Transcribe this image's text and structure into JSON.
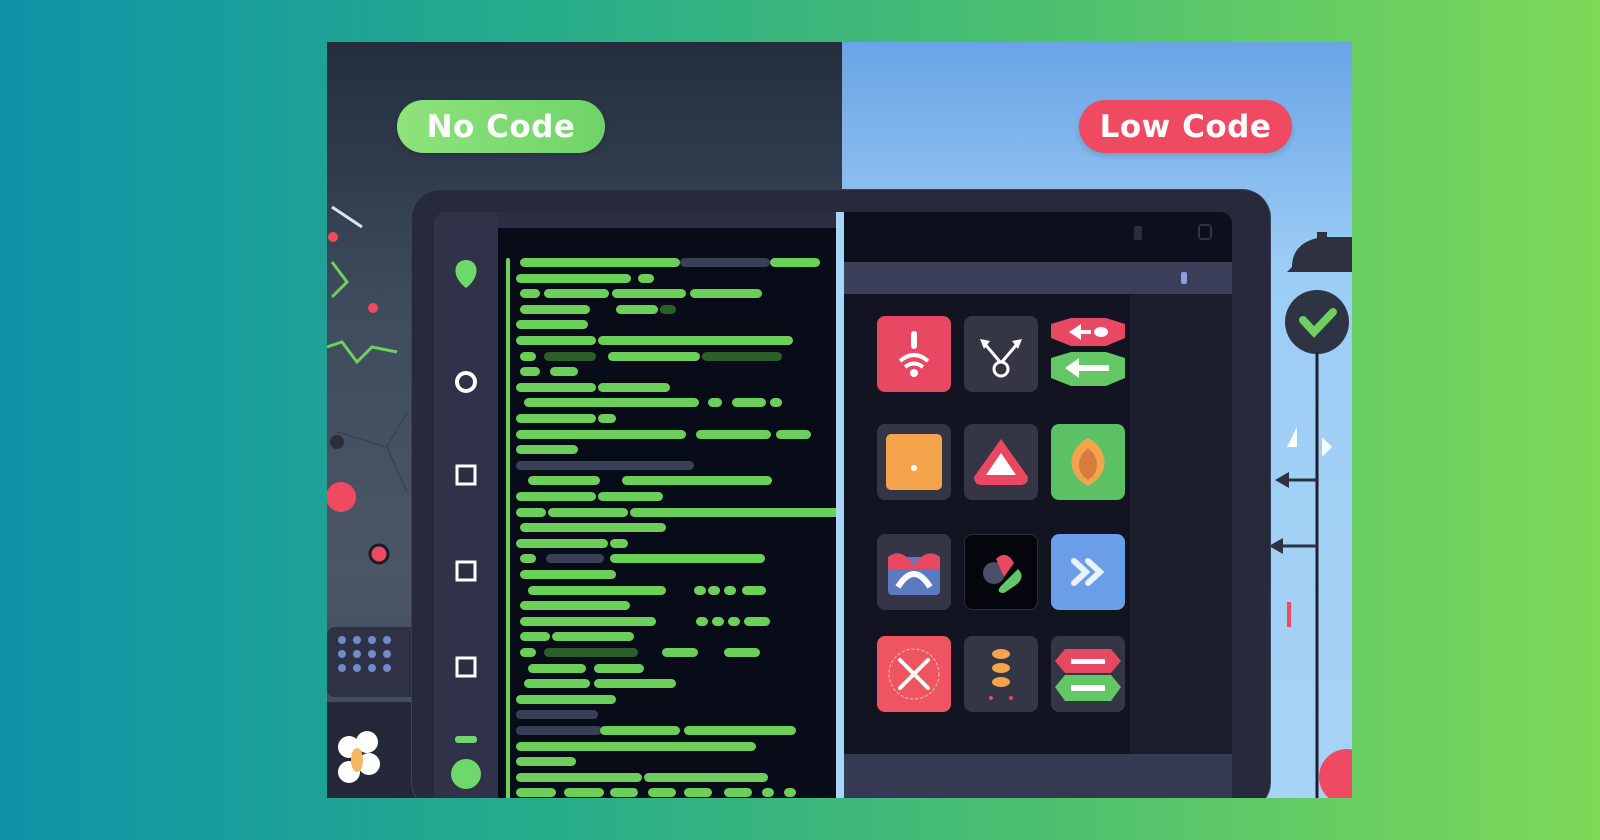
{
  "labels": {
    "no_code": "No Code",
    "low_code": "Low Code"
  },
  "colors": {
    "no_code_pill": "#7ed96c",
    "low_code_pill": "#ef4a62",
    "code_green": "#6ccf5a",
    "accent_red": "#ec4a62",
    "accent_orange": "#f4a54c",
    "accent_blue": "#6b9ee8"
  },
  "editor": {
    "sidebar_icons": [
      "leaf-icon",
      "circle-icon",
      "square-icon",
      "square-icon",
      "square-icon",
      "dash-icon",
      "dot-icon"
    ]
  },
  "builder": {
    "tiles": [
      {
        "name": "alert-wifi-tile",
        "icon": "alert-wifi-icon"
      },
      {
        "name": "branch-tile",
        "icon": "branch-arrows-icon"
      },
      {
        "name": "arrow-blocks-tile",
        "icon": "arrow-left-icon"
      },
      {
        "name": "orange-box-tile",
        "icon": "box-icon"
      },
      {
        "name": "warning-tile",
        "icon": "triangle-icon"
      },
      {
        "name": "seed-tile",
        "icon": "drop-icon"
      },
      {
        "name": "gift-tile",
        "icon": "gift-icon"
      },
      {
        "name": "shapes-tile",
        "icon": "shapes-icon"
      },
      {
        "name": "forward-tile",
        "icon": "double-chevron-right-icon"
      },
      {
        "name": "close-tile",
        "icon": "close-icon"
      },
      {
        "name": "stack-tile",
        "icon": "stack-icon"
      },
      {
        "name": "toggle-tile",
        "icon": "toggle-bars-icon"
      }
    ],
    "palette_top": [
      "caret-down-icon",
      "ring-icon",
      "arrowhead-icon",
      "bell-icon"
    ],
    "palette_bottom": [
      "dots-icon",
      "blob-icon",
      "chevrons-icon",
      "key-icon",
      "chevron-up-icon"
    ]
  }
}
